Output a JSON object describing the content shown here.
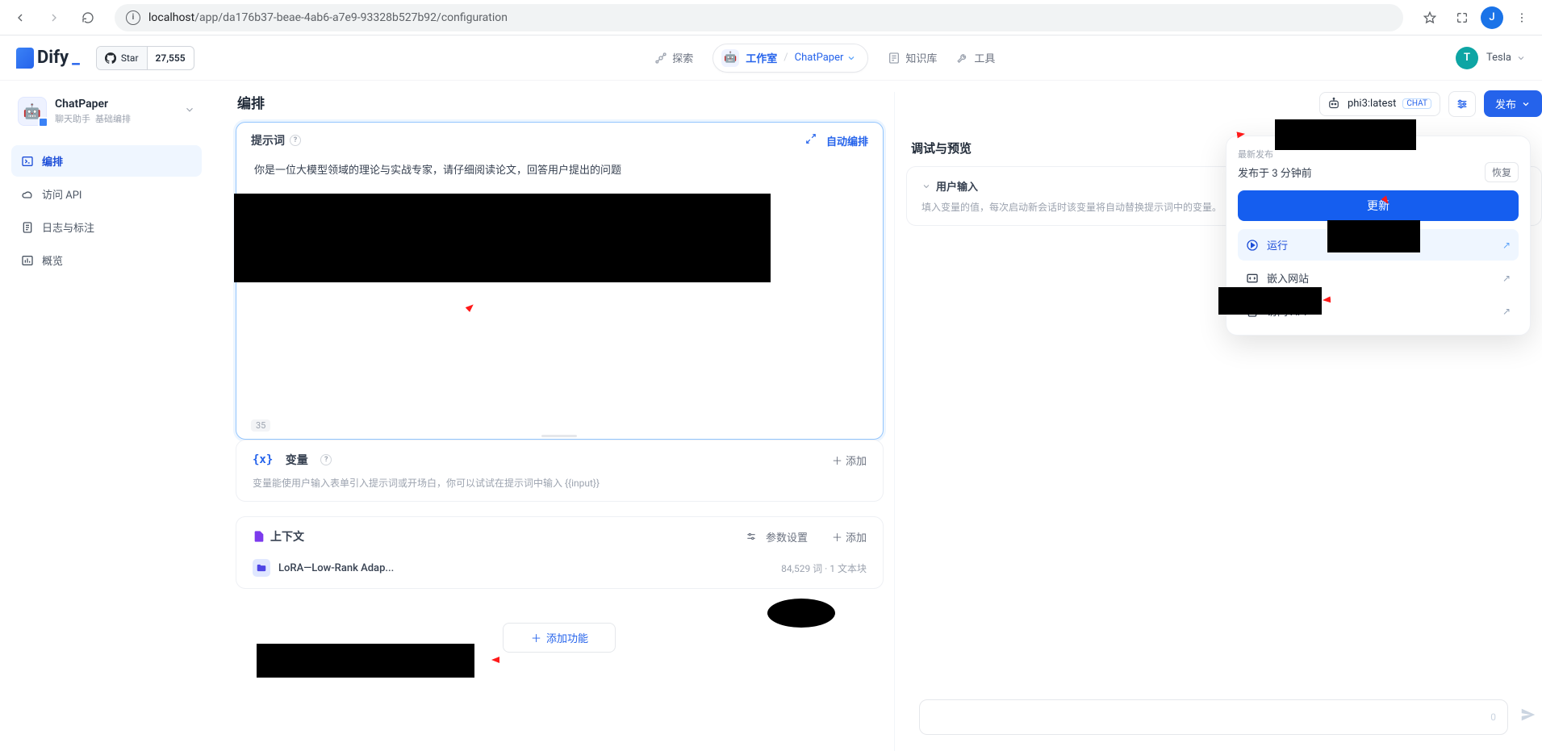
{
  "browser": {
    "url_host": "localhost",
    "url_path": "/app/da176b37-beae-4ab6-a7e9-93328b527b92/configuration",
    "profile_initial": "J"
  },
  "topnav": {
    "logo": "Dify",
    "star_label": "Star",
    "star_count": "27,555",
    "explore": "探索",
    "workspace_label": "工作室",
    "workspace_app": "ChatPaper",
    "knowledge": "知识库",
    "tools": "工具",
    "user_initial": "T",
    "user_name": "Tesla"
  },
  "sidebar": {
    "app_name": "ChatPaper",
    "app_tag1": "聊天助手",
    "app_tag2": "基础编排",
    "items": [
      "编排",
      "访问 API",
      "日志与标注",
      "概览"
    ]
  },
  "main": {
    "title": "编排",
    "prompt": {
      "title": "提示词",
      "auto_label": "自动编排",
      "text": "你是一位大模型领域的理论与实战专家，请仔细阅读论文，回答用户提出的问题",
      "char_count": "35"
    },
    "variables": {
      "title": "变量",
      "add_label": "添加",
      "hint": "变量能使用户输入表单引入提示词或开场白，你可以试试在提示词中输入 {{input}}"
    },
    "context": {
      "title": "上下文",
      "params_label": "参数设置",
      "add_label": "添加",
      "doc_name": "LoRA—Low-Rank Adap...",
      "doc_meta": "84,529 词 · 1 文本块"
    },
    "add_feature_label": "添加功能"
  },
  "right_panel": {
    "model_name": "phi3:latest",
    "model_badge": "CHAT",
    "publish_label": "发布",
    "debug_title": "调试与预览",
    "user_input_label": "用户输入",
    "user_input_hint": "填入变量的值，每次启动新会话时该变量将自动替换提示词中的变量。",
    "input_placeholder": "",
    "counter": "0"
  },
  "popover": {
    "latest_label": "最新发布",
    "published_time": "发布于 3 分钟前",
    "restore_label": "恢复",
    "update_label": "更新",
    "run_label": "运行",
    "embed_label": "嵌入网站",
    "api_label": "访问 API"
  }
}
